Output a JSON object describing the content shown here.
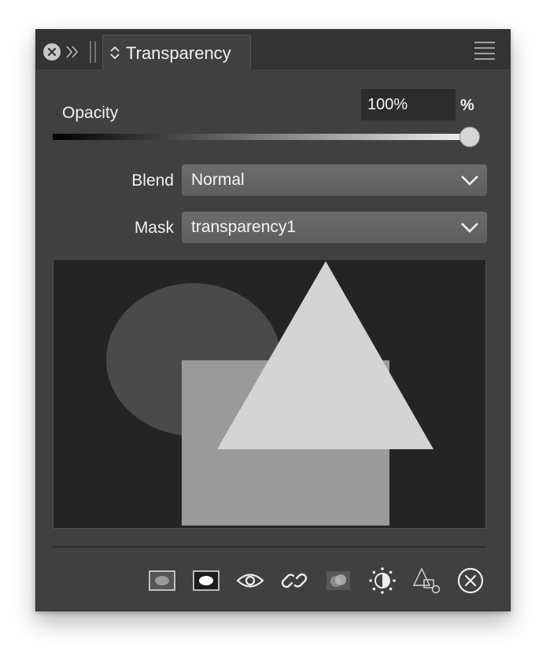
{
  "panel": {
    "tab_title": "Transparency"
  },
  "opacity": {
    "label": "Opacity",
    "value": "100%",
    "unit": "%",
    "level": 1.0
  },
  "blend": {
    "label": "Blend",
    "value": "Normal"
  },
  "mask": {
    "label": "Mask",
    "value": "transparency1"
  },
  "toolbar": {
    "icons": [
      "mask-layer-icon",
      "mask-inverted-icon",
      "eye-icon",
      "link-icon",
      "blend-circles-icon",
      "contrast-icon",
      "shapes-icon",
      "close-circle-icon"
    ]
  },
  "colors": {
    "panel_bg": "#404040",
    "preview_bg": "#242424",
    "ellipse": "#4a4a4a",
    "rectangle": "#9a9a9a",
    "triangle": "#d4d4d4"
  }
}
